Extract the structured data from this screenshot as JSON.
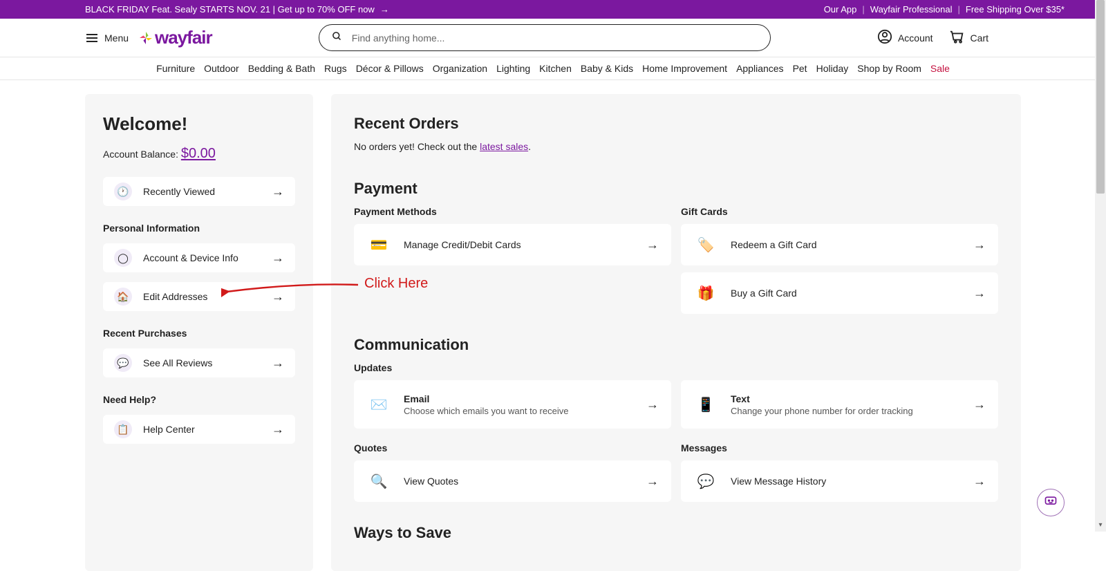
{
  "promo": {
    "left_text": "BLACK FRIDAY Feat. Sealy STARTS NOV. 21 | Get up to 70% OFF now",
    "right_items": [
      "Our App",
      "Wayfair Professional",
      "Free Shipping Over $35*"
    ]
  },
  "header": {
    "menu_label": "Menu",
    "logo_text": "wayfair",
    "search_placeholder": "Find anything home...",
    "account_label": "Account",
    "cart_label": "Cart"
  },
  "nav": {
    "items": [
      "Furniture",
      "Outdoor",
      "Bedding & Bath",
      "Rugs",
      "Décor & Pillows",
      "Organization",
      "Lighting",
      "Kitchen",
      "Baby & Kids",
      "Home Improvement",
      "Appliances",
      "Pet",
      "Holiday",
      "Shop by Room"
    ],
    "sale": "Sale"
  },
  "sidebar": {
    "welcome": "Welcome!",
    "balance_label": "Account Balance: ",
    "balance_amount": "$0.00",
    "recently_viewed": "Recently Viewed",
    "personal_info_heading": "Personal Information",
    "account_device": "Account & Device Info",
    "edit_addresses": "Edit Addresses",
    "recent_purchases_heading": "Recent Purchases",
    "see_reviews": "See All Reviews",
    "need_help_heading": "Need Help?",
    "help_center": "Help Center"
  },
  "main": {
    "recent_orders_heading": "Recent Orders",
    "no_orders_prefix": "No orders yet! Check out the ",
    "latest_sales_link": "latest sales",
    "no_orders_suffix": ".",
    "payment_heading": "Payment",
    "payment_methods_sub": "Payment Methods",
    "gift_cards_sub": "Gift Cards",
    "manage_cards": "Manage Credit/Debit Cards",
    "redeem_gift": "Redeem a Gift Card",
    "buy_gift": "Buy a Gift Card",
    "communication_heading": "Communication",
    "updates_sub": "Updates",
    "email_title": "Email",
    "email_sub": "Choose which emails you want to receive",
    "text_title": "Text",
    "text_sub": "Change your phone number for order tracking",
    "quotes_sub": "Quotes",
    "messages_sub": "Messages",
    "view_quotes": "View Quotes",
    "view_messages": "View Message History",
    "ways_to_save_heading": "Ways to Save"
  },
  "annotation": {
    "text": "Click Here"
  }
}
